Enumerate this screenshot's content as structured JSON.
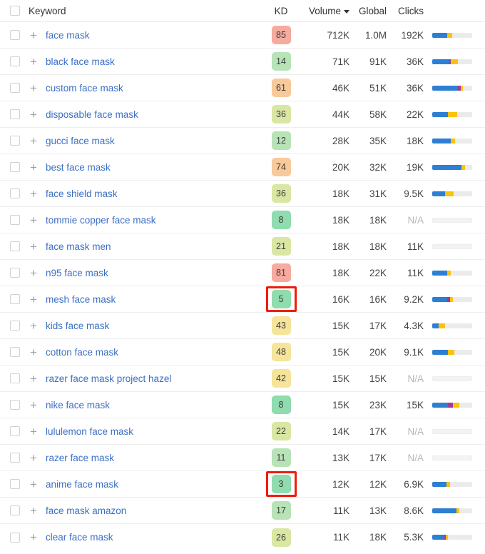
{
  "table": {
    "columns": {
      "select_all": "",
      "keyword": "Keyword",
      "kd": "KD",
      "volume": "Volume",
      "volume_sort": "descending",
      "global": "Global",
      "clicks": "Clicks",
      "serp": ""
    },
    "icons": {
      "add_keyword": "+",
      "sort_caret": "chevron-down-icon",
      "checkbox": "checkbox-icon"
    },
    "colors": {
      "kd_very_easy": "#8fdcae",
      "kd_easy": "#b7e3b7",
      "kd_medium_low": "#d9e7a3",
      "kd_medium": "#f5e49a",
      "kd_hard": "#f8c99a",
      "kd_very_hard": "#f7aaa0",
      "link": "#3b6fc4",
      "serp_blue": "#2d7fd3",
      "serp_purple": "#a0399e",
      "serp_yellow": "#fbc309",
      "serp_track": "#ebebeb",
      "annotation": "#f01c08"
    },
    "rows": [
      {
        "keyword": "face mask",
        "kd": "85",
        "kd_color": "#f7aaa0",
        "volume": "712K",
        "global": "1.0M",
        "clicks": "192K",
        "serp": [
          38,
          0,
          12
        ],
        "na": false
      },
      {
        "keyword": "black face mask",
        "kd": "14",
        "kd_color": "#b7e3b7",
        "volume": "71K",
        "global": "91K",
        "clicks": "36K",
        "serp": [
          42,
          5,
          17
        ],
        "na": false
      },
      {
        "keyword": "custom face mask",
        "kd": "61",
        "kd_color": "#f8c99a",
        "volume": "46K",
        "global": "51K",
        "clicks": "36K",
        "serp": [
          64,
          7,
          5
        ],
        "na": false
      },
      {
        "keyword": "disposable face mask",
        "kd": "36",
        "kd_color": "#d9e7a3",
        "volume": "44K",
        "global": "58K",
        "clicks": "22K",
        "serp": [
          40,
          0,
          22
        ],
        "na": false
      },
      {
        "keyword": "gucci face mask",
        "kd": "12",
        "kd_color": "#b7e3b7",
        "volume": "28K",
        "global": "35K",
        "clicks": "18K",
        "serp": [
          46,
          0,
          12
        ],
        "na": false
      },
      {
        "keyword": "best face mask",
        "kd": "74",
        "kd_color": "#f8c99a",
        "volume": "20K",
        "global": "32K",
        "clicks": "19K",
        "serp": [
          74,
          0,
          8
        ],
        "na": false
      },
      {
        "keyword": "face shield mask",
        "kd": "36",
        "kd_color": "#d9e7a3",
        "volume": "18K",
        "global": "31K",
        "clicks": "9.5K",
        "serp": [
          33,
          0,
          20
        ],
        "na": false
      },
      {
        "keyword": "tommie copper face mask",
        "kd": "8",
        "kd_color": "#8fdcae",
        "volume": "18K",
        "global": "18K",
        "clicks": "N/A",
        "serp": [
          0,
          0,
          0
        ],
        "na": true
      },
      {
        "keyword": "face mask men",
        "kd": "21",
        "kd_color": "#d9e7a3",
        "volume": "18K",
        "global": "18K",
        "clicks": "11K",
        "serp": [
          0,
          0,
          0
        ],
        "na": true
      },
      {
        "keyword": "n95 face mask",
        "kd": "81",
        "kd_color": "#f7aaa0",
        "volume": "18K",
        "global": "22K",
        "clicks": "11K",
        "serp": [
          38,
          0,
          9
        ],
        "na": false
      },
      {
        "keyword": "mesh face mask",
        "kd": "5",
        "kd_color": "#8fdcae",
        "volume": "16K",
        "global": "16K",
        "clicks": "9.2K",
        "serp": [
          38,
          6,
          8
        ],
        "na": false,
        "highlight_kd": true
      },
      {
        "keyword": "kids face mask",
        "kd": "43",
        "kd_color": "#f5e49a",
        "volume": "15K",
        "global": "17K",
        "clicks": "4.3K",
        "serp": [
          16,
          0,
          16
        ],
        "na": false
      },
      {
        "keyword": "cotton face mask",
        "kd": "48",
        "kd_color": "#f5e49a",
        "volume": "15K",
        "global": "20K",
        "clicks": "9.1K",
        "serp": [
          40,
          0,
          15
        ],
        "na": false
      },
      {
        "keyword": "razer face mask project hazel",
        "kd": "42",
        "kd_color": "#f5e49a",
        "volume": "15K",
        "global": "15K",
        "clicks": "N/A",
        "serp": [
          0,
          0,
          0
        ],
        "na": true
      },
      {
        "keyword": "nike face mask",
        "kd": "8",
        "kd_color": "#8fdcae",
        "volume": "15K",
        "global": "23K",
        "clicks": "15K",
        "serp": [
          40,
          12,
          15
        ],
        "na": false
      },
      {
        "keyword": "lululemon face mask",
        "kd": "22",
        "kd_color": "#d9e7a3",
        "volume": "14K",
        "global": "17K",
        "clicks": "N/A",
        "serp": [
          0,
          0,
          0
        ],
        "na": true
      },
      {
        "keyword": "razer face mask",
        "kd": "11",
        "kd_color": "#b7e3b7",
        "volume": "13K",
        "global": "17K",
        "clicks": "N/A",
        "serp": [
          0,
          0,
          0
        ],
        "na": true
      },
      {
        "keyword": "anime face mask",
        "kd": "3",
        "kd_color": "#8fdcae",
        "volume": "12K",
        "global": "12K",
        "clicks": "6.9K",
        "serp": [
          36,
          0,
          8
        ],
        "na": false,
        "highlight_kd": true
      },
      {
        "keyword": "face mask amazon",
        "kd": "17",
        "kd_color": "#b7e3b7",
        "volume": "11K",
        "global": "13K",
        "clicks": "8.6K",
        "serp": [
          60,
          0,
          8
        ],
        "na": false
      },
      {
        "keyword": "clear face mask",
        "kd": "26",
        "kd_color": "#d9e7a3",
        "volume": "11K",
        "global": "18K",
        "clicks": "5.3K",
        "serp": [
          30,
          4,
          6
        ],
        "na": false
      }
    ]
  }
}
